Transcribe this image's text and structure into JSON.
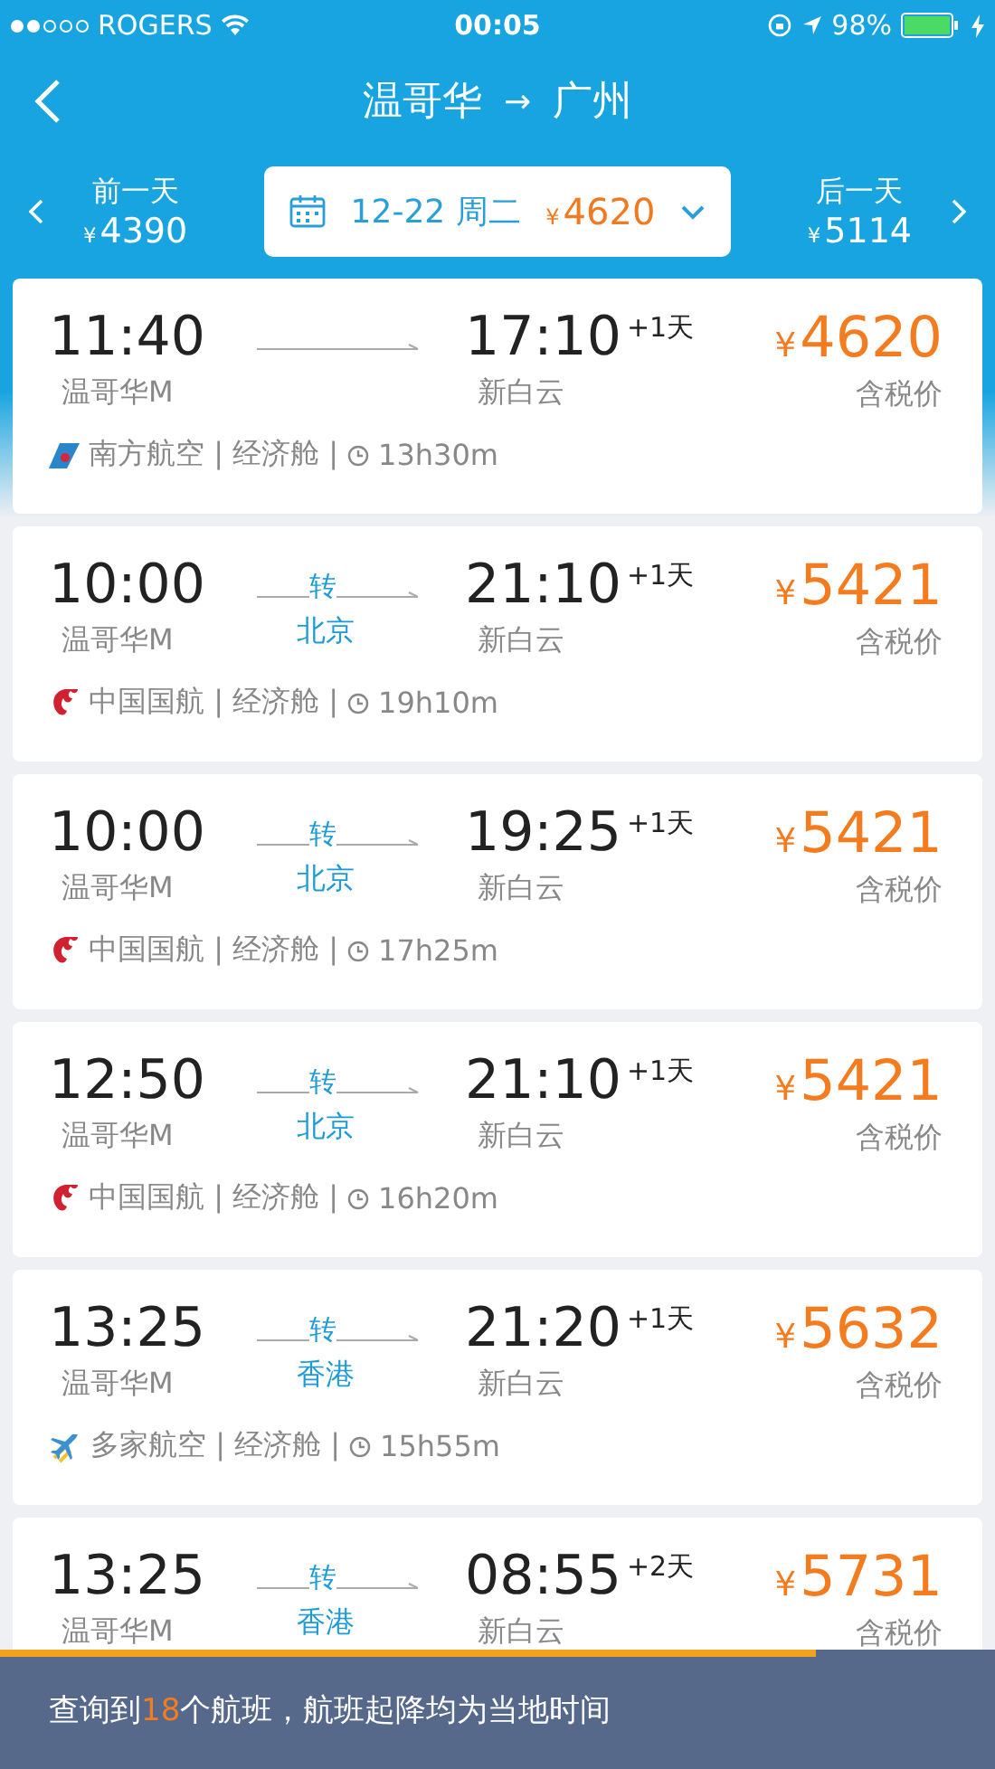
{
  "status_bar": {
    "carrier": "ROGERS",
    "time": "00:05",
    "battery": "98%"
  },
  "nav": {
    "title_from": "温哥华",
    "title_arrow": "→",
    "title_to": "广州"
  },
  "date_bar": {
    "prev": {
      "label": "前一天",
      "price": "4390"
    },
    "current": {
      "date": "12-22 周二",
      "price": "4620"
    },
    "next": {
      "label": "后一天",
      "price": "5114"
    },
    "currency": "¥"
  },
  "flights": [
    {
      "depart": "11:40",
      "depart_airport": "温哥华M",
      "arrive": "17:10",
      "day_offset": "+1天",
      "arrive_airport": "新白云",
      "price": "4620",
      "price_note": "含税价",
      "kind": "southern",
      "info": "南方航空 | 经济舱 |",
      "duration": "13h30m"
    },
    {
      "depart": "10:00",
      "depart_airport": "温哥华M",
      "arrive": "21:10",
      "day_offset": "+1天",
      "arrive_airport": "新白云",
      "transfer": {
        "label": "转",
        "city": "北京"
      },
      "price": "5421",
      "price_note": "含税价",
      "kind": "airchina",
      "info": "中国国航 | 经济舱 |",
      "duration": "19h10m"
    },
    {
      "depart": "10:00",
      "depart_airport": "温哥华M",
      "arrive": "19:25",
      "day_offset": "+1天",
      "arrive_airport": "新白云",
      "transfer": {
        "label": "转",
        "city": "北京"
      },
      "price": "5421",
      "price_note": "含税价",
      "kind": "airchina",
      "info": "中国国航 | 经济舱 |",
      "duration": "17h25m"
    },
    {
      "depart": "12:50",
      "depart_airport": "温哥华M",
      "arrive": "21:10",
      "day_offset": "+1天",
      "arrive_airport": "新白云",
      "transfer": {
        "label": "转",
        "city": "北京"
      },
      "price": "5421",
      "price_note": "含税价",
      "kind": "airchina",
      "info": "中国国航 | 经济舱 |",
      "duration": "16h20m"
    },
    {
      "depart": "13:25",
      "depart_airport": "温哥华M",
      "arrive": "21:20",
      "day_offset": "+1天",
      "arrive_airport": "新白云",
      "transfer": {
        "label": "转",
        "city": "香港"
      },
      "price": "5632",
      "price_note": "含税价",
      "kind": "multi",
      "info": "多家航空 | 经济舱 |",
      "duration": "15h55m"
    },
    {
      "depart": "13:25",
      "depart_airport": "温哥华M",
      "arrive": "08:55",
      "day_offset": "+2天",
      "arrive_airport": "新白云",
      "transfer": {
        "label": "转",
        "city": "香港"
      },
      "price": "5731",
      "price_note": "含税价"
    }
  ],
  "toast": {
    "before": "查询到",
    "count": "18",
    "after": "个航班，航班起降均为当地时间",
    "level": 0.82
  }
}
